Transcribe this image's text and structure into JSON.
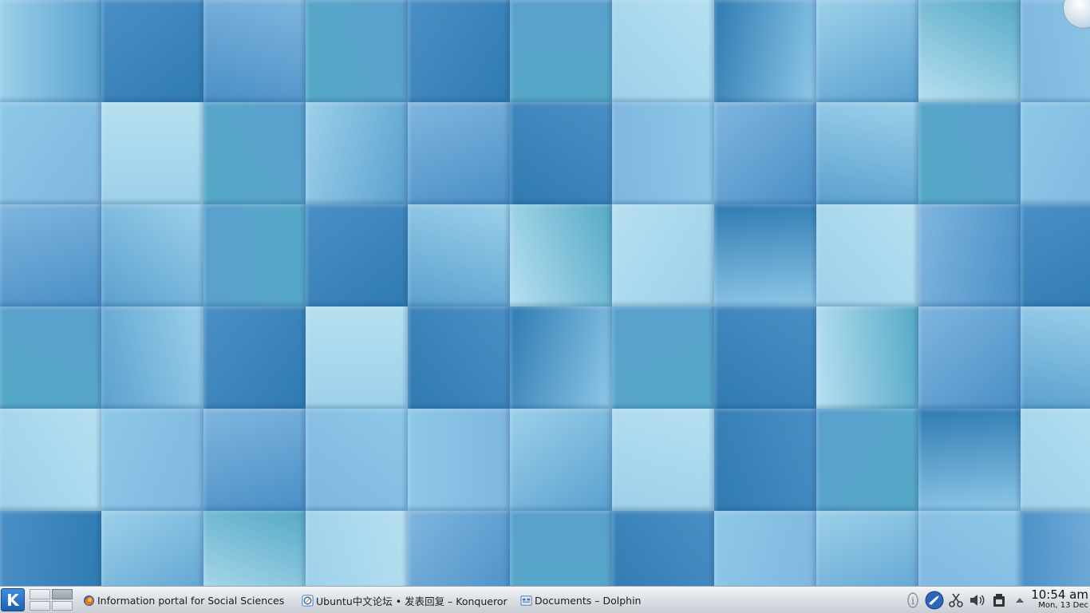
{
  "desktop": {
    "wallpaper": {
      "tile_columns": 11,
      "tile_rows": 6,
      "palette": [
        "#9cd0ea",
        "#7fb6df",
        "#5aa0cf",
        "#4a8fc6",
        "#56a9c7",
        "#2f7bb2",
        "#b6e0f0",
        "#8ec8e8"
      ]
    }
  },
  "taskbar": {
    "launcher_icon": "kde-k-icon",
    "launcher_glyph": "K",
    "tasks": [
      {
        "label": "Information portal for Social Sciences -",
        "icon": "firefox-icon"
      },
      {
        "label": "Ubuntu中文论坛 • 发表回复 – Konqueror",
        "icon": "konqueror-icon"
      },
      {
        "label": "Documents – Dolphin",
        "icon": "dolphin-icon"
      }
    ],
    "tray": {
      "icons": [
        "info-icon",
        "network-icon",
        "klipper-scissors-icon",
        "volume-icon",
        "device-notifier-icon",
        "expand-arrow-icon"
      ]
    },
    "clock": {
      "time": "10:54 am",
      "date": "Mon, 13 Dec"
    }
  },
  "colors": {
    "kde_blue": "#1c5fb0",
    "panel_light": "#f3f5f7",
    "panel_dark": "#c8ced4"
  }
}
